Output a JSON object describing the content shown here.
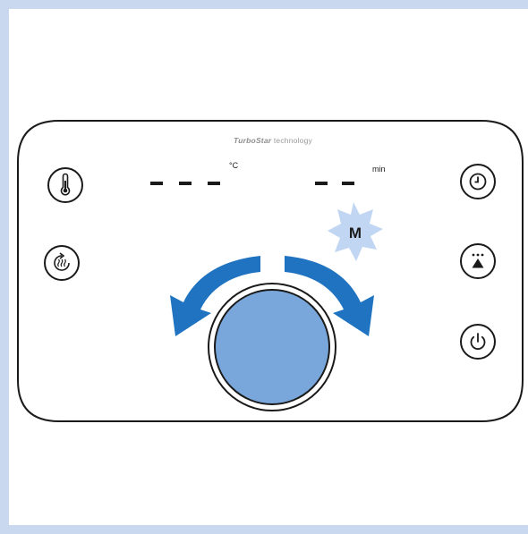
{
  "brand": {
    "name": "TurboStar",
    "suffix": "technology"
  },
  "display": {
    "temperature": {
      "value": "- - -",
      "unit": "°C"
    },
    "time": {
      "value": "- -",
      "unit": "min"
    }
  },
  "badge": {
    "label": "M"
  },
  "buttons": [
    {
      "id": "temperature",
      "icon": "thermometer-icon"
    },
    {
      "id": "steam",
      "icon": "steam-cycle-icon"
    },
    {
      "id": "timer",
      "icon": "clock-icon"
    },
    {
      "id": "steam-boost",
      "icon": "steam-triangle-icon"
    },
    {
      "id": "power",
      "icon": "power-icon"
    }
  ],
  "colors": {
    "frame": "#c9d8ee",
    "arrows": "#1f73c1",
    "dial": "#79a7dc",
    "badge_burst": "#c1d6f2",
    "outline": "#1a1a1a"
  }
}
